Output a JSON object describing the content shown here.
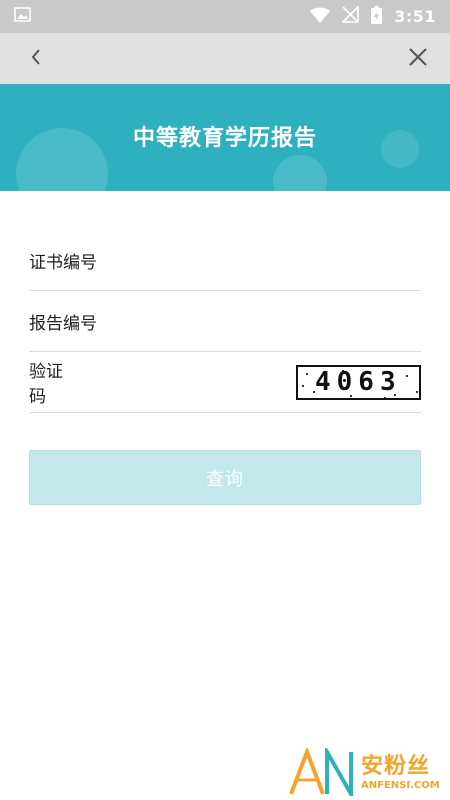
{
  "status_bar": {
    "time": "3:51",
    "icons": [
      "image-icon",
      "wifi-icon",
      "no-signal-icon",
      "battery-charging-icon"
    ]
  },
  "toolbar": {
    "back_icon": "chevron-left-icon",
    "close_icon": "close-icon"
  },
  "banner": {
    "title": "中等教育学历报告"
  },
  "form": {
    "certificate_label": "证书编号",
    "certificate_value": "",
    "report_label": "报告编号",
    "report_value": "",
    "captcha_label": "验证码",
    "captcha_value": "",
    "captcha_code": "4063"
  },
  "submit": {
    "label": "查询"
  },
  "watermark": {
    "cn": "安粉丝",
    "en": "ANFENSI.COM"
  },
  "colors": {
    "banner": "#2fb0bf",
    "button_disabled": "#c2e8ec",
    "watermark": "#f4a42b"
  }
}
